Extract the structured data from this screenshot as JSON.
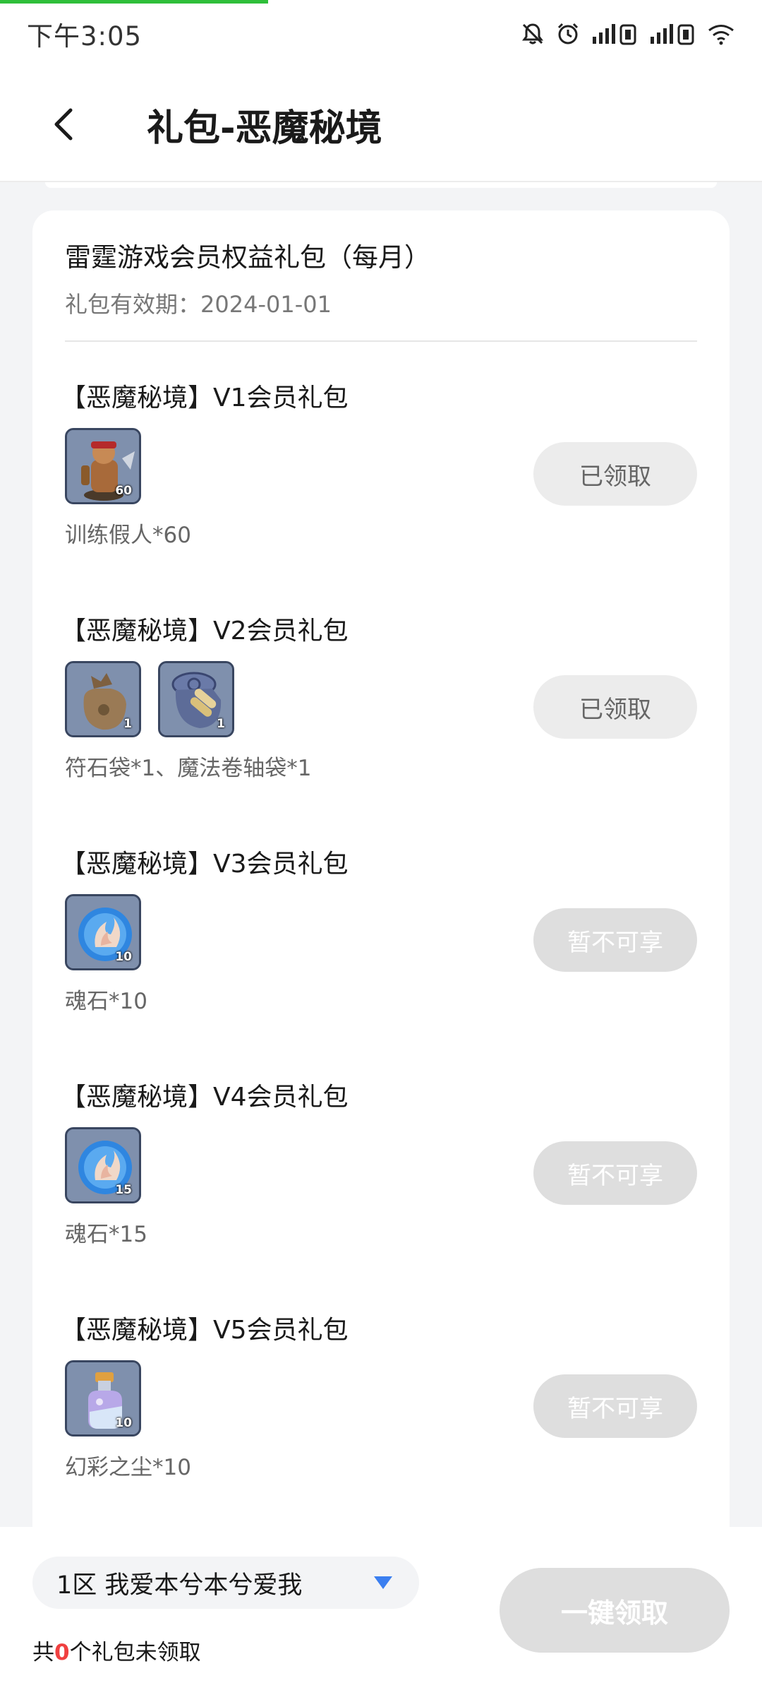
{
  "status_bar": {
    "time": "下午3:05"
  },
  "header": {
    "title": "礼包-恶魔秘境"
  },
  "card": {
    "title": "雷霆游戏会员权益礼包（每月）",
    "validity": "礼包有效期：2024-01-01"
  },
  "packs": [
    {
      "title": "【恶魔秘境】V1会员礼包",
      "items": [
        {
          "icon": "training-dummy-icon",
          "count": "60"
        }
      ],
      "desc": "训练假人*60",
      "button": "已领取",
      "state": "claimed"
    },
    {
      "title": "【恶魔秘境】V2会员礼包",
      "items": [
        {
          "icon": "rune-bag-icon",
          "count": "1"
        },
        {
          "icon": "scroll-bag-icon",
          "count": "1"
        }
      ],
      "desc": " 符石袋*1、魔法卷轴袋*1",
      "button": "已领取",
      "state": "claimed"
    },
    {
      "title": "【恶魔秘境】V3会员礼包",
      "items": [
        {
          "icon": "soul-stone-icon",
          "count": "10"
        }
      ],
      "desc": " 魂石*10",
      "button": "暂不可享",
      "state": "unavailable"
    },
    {
      "title": "【恶魔秘境】V4会员礼包",
      "items": [
        {
          "icon": "soul-stone-icon",
          "count": "15"
        }
      ],
      "desc": "魂石*15",
      "button": "暂不可享",
      "state": "unavailable"
    },
    {
      "title": "【恶魔秘境】V5会员礼包",
      "items": [
        {
          "icon": "illusion-dust-icon",
          "count": "10"
        }
      ],
      "desc": "幻彩之尘*10",
      "button": "暂不可享",
      "state": "unavailable"
    }
  ],
  "footer": {
    "server": "1区 我爱本兮本兮爱我",
    "unclaimed_prefix": "共",
    "unclaimed_count": "0",
    "unclaimed_suffix": "个礼包未领取",
    "claim_all": "一键领取"
  },
  "colors": {
    "accent_blue": "#3b7ff0",
    "count_red": "#f04040",
    "progress_green": "#2fbf3a"
  }
}
